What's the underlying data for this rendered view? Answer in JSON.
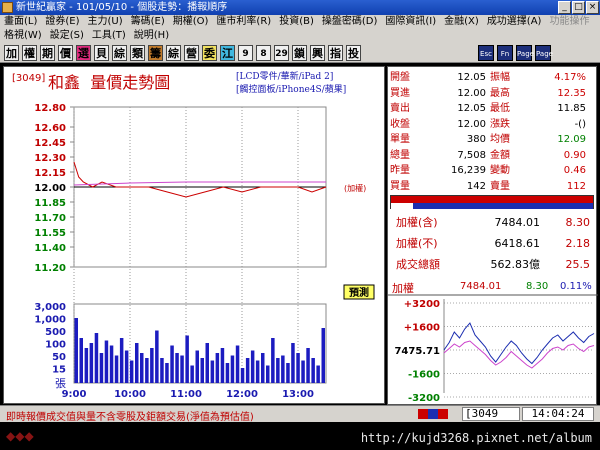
{
  "window": {
    "title": "新世紀贏家 - 101/05/10 - 個股走勢：播報順序"
  },
  "menu1": [
    "畫面(L)",
    "證券(E)",
    "主力(U)",
    "籌碼(E)",
    "期權(O)",
    "匯市利率(R)",
    "投資(B)",
    "操盤密碼(D)",
    "國際資訊(I)",
    "金融(X)",
    "成功選擇(A)",
    "功能操作"
  ],
  "menu2": [
    "格視(W)",
    "設定(S)",
    "工具(T)",
    "說明(H)"
  ],
  "toolbar": {
    "buttons": [
      "加",
      "權",
      "期",
      "價",
      "選",
      "貝",
      "綜",
      "類",
      "籌",
      "綜",
      "營",
      "委",
      "江",
      "9",
      "8",
      "29",
      "鎖",
      "興",
      "指",
      "投"
    ],
    "fn_buttons": [
      "Esc",
      "Fn",
      "Page",
      "Page"
    ]
  },
  "chart": {
    "code_label": "[3049]",
    "stock_name": "和鑫",
    "chart_title": "量價走勢圖",
    "tags": [
      "[LCD零件/華新/iPad 2]",
      "[觸控面板/iPhone4S/蘋果]"
    ],
    "ref_line_label": "(加權)",
    "forecast_badge": "預測",
    "volume_unit": "張"
  },
  "chart_data": {
    "type": "line",
    "price_ylim": [
      11.2,
      12.8
    ],
    "price_ticks": [
      "12.80",
      "12.60",
      "12.45",
      "12.30",
      "12.15",
      "12.00",
      "11.85",
      "11.70",
      "11.55",
      "11.40",
      "11.20"
    ],
    "reference_price": 12.0,
    "volume_ticks": [
      "3,000",
      "1,000",
      "500",
      "100",
      "50",
      "15"
    ],
    "x_ticks": [
      "9:00",
      "10:00",
      "11:00",
      "12:00",
      "13:00"
    ],
    "series": [
      {
        "name": "",
        "color": "#cc0000",
        "x": [
          "9:00",
          "9:05",
          "9:10",
          "9:20",
          "9:30",
          "9:45",
          "10:00",
          "10:20",
          "10:40",
          "11:00",
          "11:20",
          "11:40",
          "12:00",
          "12:20",
          "12:40",
          "13:00",
          "13:15",
          "13:30"
        ],
        "y": [
          12.25,
          12.1,
          12.05,
          12.0,
          12.05,
          12.0,
          12.0,
          12.0,
          11.95,
          11.9,
          11.95,
          12.0,
          11.95,
          12.0,
          12.0,
          12.0,
          11.95,
          12.0
        ]
      },
      {
        "name": "",
        "color": "#cc44cc",
        "x": [
          "9:00",
          "9:30",
          "10:00",
          "11:00",
          "12:00",
          "13:00",
          "13:30"
        ],
        "y": [
          12.02,
          12.03,
          12.04,
          12.05,
          12.05,
          12.05,
          12.05
        ]
      }
    ],
    "volume": [
      2.6,
      1.8,
      1.4,
      1.6,
      2.0,
      1.2,
      1.7,
      1.5,
      1.1,
      1.8,
      1.3,
      0.9,
      1.6,
      1.2,
      1.0,
      1.4,
      2.1,
      1.0,
      0.8,
      1.5,
      1.2,
      1.1,
      1.9,
      0.7,
      1.3,
      1.0,
      1.6,
      0.9,
      1.2,
      1.4,
      0.8,
      1.1,
      1.5,
      0.6,
      1.0,
      1.3,
      0.9,
      1.2,
      0.7,
      1.8,
      1.0,
      1.1,
      0.8,
      1.6,
      1.2,
      0.9,
      1.4,
      1.0,
      0.7,
      2.2
    ]
  },
  "quote": {
    "rows": [
      {
        "l": "開盤",
        "v": "12.05",
        "l2": "振幅",
        "v2": "4.17%",
        "c2": "#cc0000"
      },
      {
        "l": "買進",
        "v": "12.00",
        "l2": "最高",
        "v2": "12.35",
        "c2": "#cc0000"
      },
      {
        "l": "賣出",
        "v": "12.05",
        "l2": "最低",
        "v2": "11.85",
        "c2": "#000000"
      },
      {
        "l": "收盤",
        "v": "12.00",
        "l2": "漲跌",
        "v2": "-()",
        "c2": "#000000"
      },
      {
        "l": "單量",
        "v": "380",
        "l2": "均價",
        "v2": "12.09",
        "c2": "#008000"
      },
      {
        "l": "總量",
        "v": "7,508",
        "l2": "金額",
        "v2": "0.90",
        "c2": "#cc0000"
      },
      {
        "l": "昨量",
        "v": "16,239",
        "l2": "變動",
        "v2": "0.46",
        "c2": "#cc0000"
      },
      {
        "l": "買量",
        "v": "142",
        "l2": "賣量",
        "v2": "112",
        "c2": "#cc0000"
      }
    ],
    "index": [
      {
        "l": "加權(含)",
        "v": "7484.01",
        "c": "8.30"
      },
      {
        "l": "加權(不)",
        "v": "6418.61",
        "c": "2.18"
      },
      {
        "l": "成交總額",
        "v": "562.83億",
        "c": "25.5"
      }
    ],
    "mini": {
      "label": "加權",
      "value": "7484.01",
      "change": "8.30",
      "percent": "0.11%",
      "yticks": [
        "+3200",
        "+1600",
        "7475.71",
        "-1600",
        "-3200"
      ]
    }
  },
  "status": {
    "notice": "即時報價成交值與量不含零股及鉅額交易(淨值為預估值)",
    "code": "[3049",
    "time": "14:04:24"
  },
  "watermark": {
    "url": "http://kujd3268.pixnet.net/album"
  }
}
